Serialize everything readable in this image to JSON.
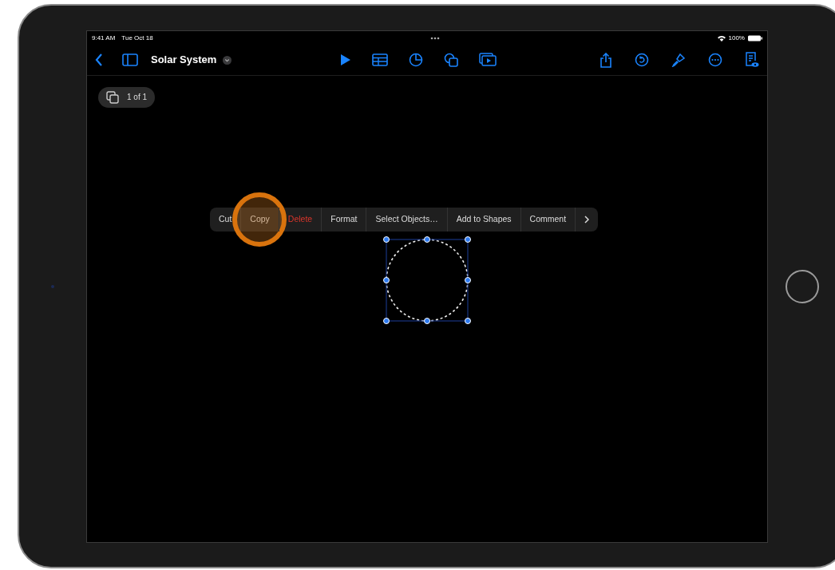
{
  "status_bar": {
    "time": "9:41 AM",
    "date": "Tue Oct 18",
    "battery": "100%"
  },
  "toolbar": {
    "title": "Solar System"
  },
  "page_indicator": "1 of 1",
  "context_menu": {
    "items": [
      {
        "label": "Cut",
        "destructive": false,
        "pressed": false
      },
      {
        "label": "Copy",
        "destructive": false,
        "pressed": true
      },
      {
        "label": "Delete",
        "destructive": true,
        "pressed": false
      },
      {
        "label": "Format",
        "destructive": false,
        "pressed": false
      },
      {
        "label": "Select Objects…",
        "destructive": false,
        "pressed": false
      },
      {
        "label": "Add to Shapes",
        "destructive": false,
        "pressed": false
      },
      {
        "label": "Comment",
        "destructive": false,
        "pressed": false
      }
    ]
  },
  "shape": {
    "selected": true
  }
}
